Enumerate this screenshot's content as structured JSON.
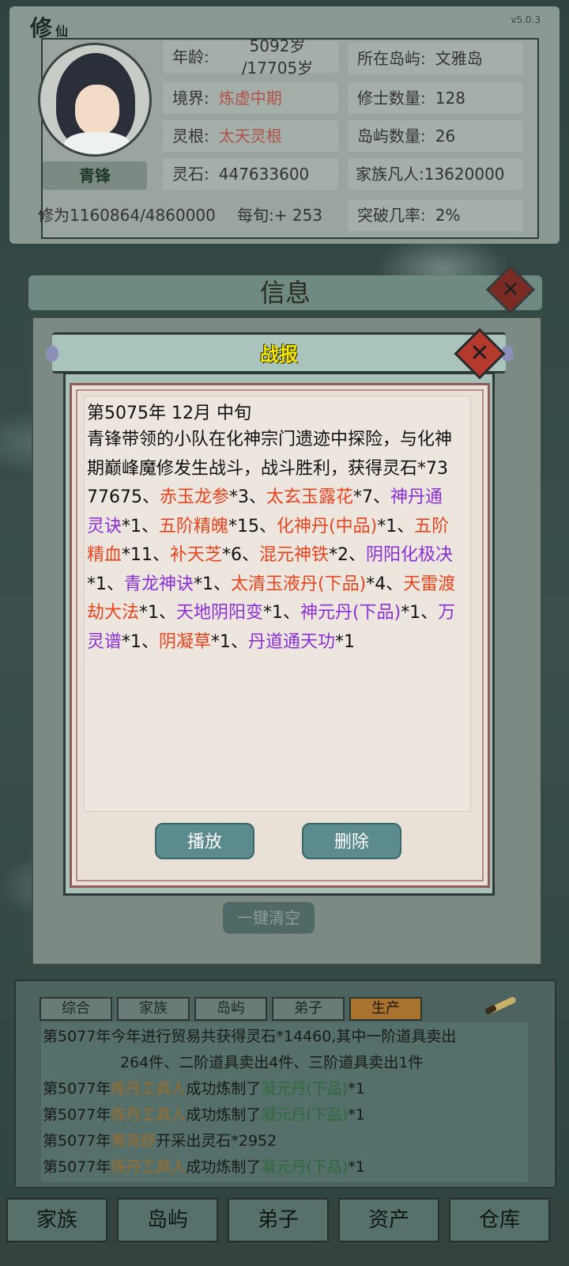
{
  "top_panel": {
    "title": "修",
    "title_small": "仙",
    "version": "v5.0.3",
    "character_name": "青锋",
    "age_label": "年龄:",
    "age_value_line1": "5092岁",
    "age_value_line2": "/17705岁",
    "island_label": "所在岛屿:",
    "island_value": "文雅岛",
    "realm_label": "境界:",
    "realm_value": "炼虚中期",
    "cultivator_count_label": "修士数量:",
    "cultivator_count_value": "128",
    "root_label": "灵根:",
    "root_value": "太天灵根",
    "island_count_label": "岛屿数量:",
    "island_count_value": "26",
    "spirit_stone_label": "灵石:",
    "spirit_stone_value": "447633600",
    "family_mortals": "家族凡人:13620000",
    "cultivation": "修为1160864/4860000",
    "per_period": "每旬:+ 253",
    "breakthrough_label": "突破几率:",
    "breakthrough_value": "2%"
  },
  "info_panel": {
    "title": "信息",
    "close_glyph": "✕",
    "clear_all": "一键清空"
  },
  "dialog": {
    "title": "战报",
    "close_glyph": "✕",
    "date": "第5075年 12月 中旬",
    "segments": [
      {
        "t": "青锋带领的小队在化神宗门遗迹中探险，与化神期巅峰魔修发生战斗，战斗胜利，获得灵石*7377675、",
        "c": "plain"
      },
      {
        "t": "赤玉龙参",
        "c": "orange"
      },
      {
        "t": "*3、",
        "c": "plain"
      },
      {
        "t": "太玄玉露花",
        "c": "orange"
      },
      {
        "t": "*7、",
        "c": "plain"
      },
      {
        "t": "神丹通灵诀",
        "c": "purple"
      },
      {
        "t": "*1、",
        "c": "plain"
      },
      {
        "t": "五阶精魄",
        "c": "orange"
      },
      {
        "t": "*15、",
        "c": "plain"
      },
      {
        "t": "化神丹(中品)",
        "c": "orange"
      },
      {
        "t": "*1、",
        "c": "plain"
      },
      {
        "t": "五阶精血",
        "c": "orange"
      },
      {
        "t": "*11、",
        "c": "plain"
      },
      {
        "t": "补天芝",
        "c": "orange"
      },
      {
        "t": "*6、",
        "c": "plain"
      },
      {
        "t": "混元神铁",
        "c": "orange"
      },
      {
        "t": "*2、",
        "c": "plain"
      },
      {
        "t": "阴阳化极决",
        "c": "purple"
      },
      {
        "t": "*1、",
        "c": "plain"
      },
      {
        "t": "青龙神诀",
        "c": "purple"
      },
      {
        "t": "*1、",
        "c": "plain"
      },
      {
        "t": "太清玉液丹(下品)",
        "c": "orange"
      },
      {
        "t": "*4、",
        "c": "plain"
      },
      {
        "t": "天雷渡劫大法",
        "c": "orange"
      },
      {
        "t": "*1、",
        "c": "plain"
      },
      {
        "t": "天地阴阳变",
        "c": "purple"
      },
      {
        "t": "*1、",
        "c": "plain"
      },
      {
        "t": "神元丹(下品)",
        "c": "purple"
      },
      {
        "t": "*1、",
        "c": "plain"
      },
      {
        "t": "万灵谱",
        "c": "purple"
      },
      {
        "t": "*1、",
        "c": "plain"
      },
      {
        "t": "阴凝草",
        "c": "orange"
      },
      {
        "t": "*1、",
        "c": "plain"
      },
      {
        "t": "丹道通天功",
        "c": "purple"
      },
      {
        "t": "*1",
        "c": "plain"
      }
    ],
    "play_button": "播放",
    "delete_button": "删除"
  },
  "log_panel": {
    "tabs": [
      "综合",
      "家族",
      "岛屿",
      "弟子",
      "生产"
    ],
    "active_tab": 4,
    "lines": [
      {
        "year": "第5077年",
        "parts": [
          {
            "t": "今年进行贸易共获得灵石*14460,其中一阶道具卖出",
            "c": "yr"
          }
        ]
      },
      {
        "year": "",
        "parts": [
          {
            "t": "264件、二阶道具卖出4件、三阶道具卖出1件",
            "c": "yr"
          }
        ]
      },
      {
        "year": "第5077年",
        "parts": [
          {
            "t": "炼丹工具人",
            "c": "or"
          },
          {
            "t": "成功炼制了",
            "c": "yr"
          },
          {
            "t": "凝元丹(下品)",
            "c": "gr"
          },
          {
            "t": "*1",
            "c": "yr"
          }
        ]
      },
      {
        "year": "第5077年",
        "parts": [
          {
            "t": "炼丹工具人",
            "c": "or"
          },
          {
            "t": "成功炼制了",
            "c": "yr"
          },
          {
            "t": "凝元丹(下品)",
            "c": "gr"
          },
          {
            "t": "*1",
            "c": "yr"
          }
        ]
      },
      {
        "year": "第5077年",
        "parts": [
          {
            "t": "青尧舒",
            "c": "or"
          },
          {
            "t": "开采出灵石*2952",
            "c": "yr"
          }
        ]
      },
      {
        "year": "第5077年",
        "parts": [
          {
            "t": "炼丹工具人",
            "c": "or"
          },
          {
            "t": "成功炼制了",
            "c": "yr"
          },
          {
            "t": "凝元丹(下品)",
            "c": "gr"
          },
          {
            "t": "*1",
            "c": "yr"
          }
        ]
      }
    ]
  },
  "bottom_nav": [
    "家族",
    "岛屿",
    "弟子",
    "资产",
    "仓库"
  ]
}
